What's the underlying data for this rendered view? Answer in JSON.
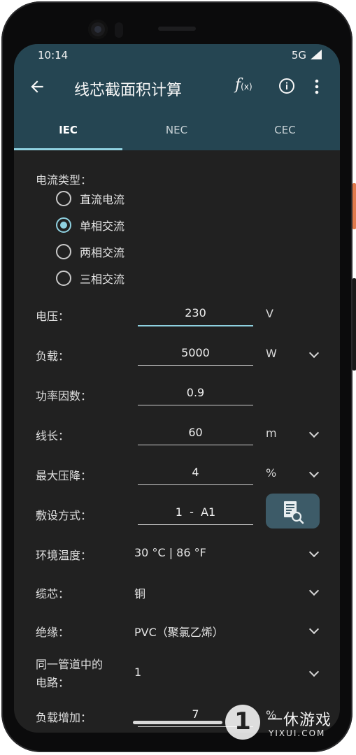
{
  "status_bar": {
    "time": "10:14",
    "network": "5G"
  },
  "app_bar": {
    "title": "线芯截面积计算",
    "fx_label": "f",
    "fx_sub": "(x)"
  },
  "tabs": [
    {
      "label": "IEC",
      "active": true
    },
    {
      "label": "NEC",
      "active": false
    },
    {
      "label": "CEC",
      "active": false
    }
  ],
  "current_type": {
    "label": "电流类型：",
    "options": [
      {
        "label": "直流电流",
        "checked": false
      },
      {
        "label": "单相交流",
        "checked": true
      },
      {
        "label": "两相交流",
        "checked": false
      },
      {
        "label": "三相交流",
        "checked": false
      }
    ]
  },
  "fields": {
    "voltage": {
      "label": "电压：",
      "value": "230",
      "unit": "V"
    },
    "load": {
      "label": "负载：",
      "value": "5000",
      "unit": "W"
    },
    "power_factor": {
      "label": "功率因数：",
      "value": "0.9"
    },
    "length": {
      "label": "线长：",
      "value": "60",
      "unit": "m"
    },
    "max_drop": {
      "label": "最大压降：",
      "value": "4",
      "unit": "%"
    },
    "install_method": {
      "label": "敷设方式：",
      "value": "1  -  A1"
    },
    "ambient_temp": {
      "label": "环境温度：",
      "value": "30 °C | 86 °F"
    },
    "core": {
      "label": "缆芯：",
      "value": "铜"
    },
    "insulation": {
      "label": "绝缘：",
      "value": "PVC（聚氯乙烯）"
    },
    "circuits": {
      "label_line1": "同一管道中的",
      "label_line2": "电路：",
      "value": "1"
    },
    "load_increase": {
      "label": "负载增加：",
      "value": "7",
      "unit": "%"
    }
  },
  "watermark": {
    "badge": "1",
    "text": "一休游戏",
    "sub": "YIXUI.COM"
  },
  "colors": {
    "appbar": "#254552",
    "accent": "#8fd1e0",
    "background": "#212121"
  }
}
